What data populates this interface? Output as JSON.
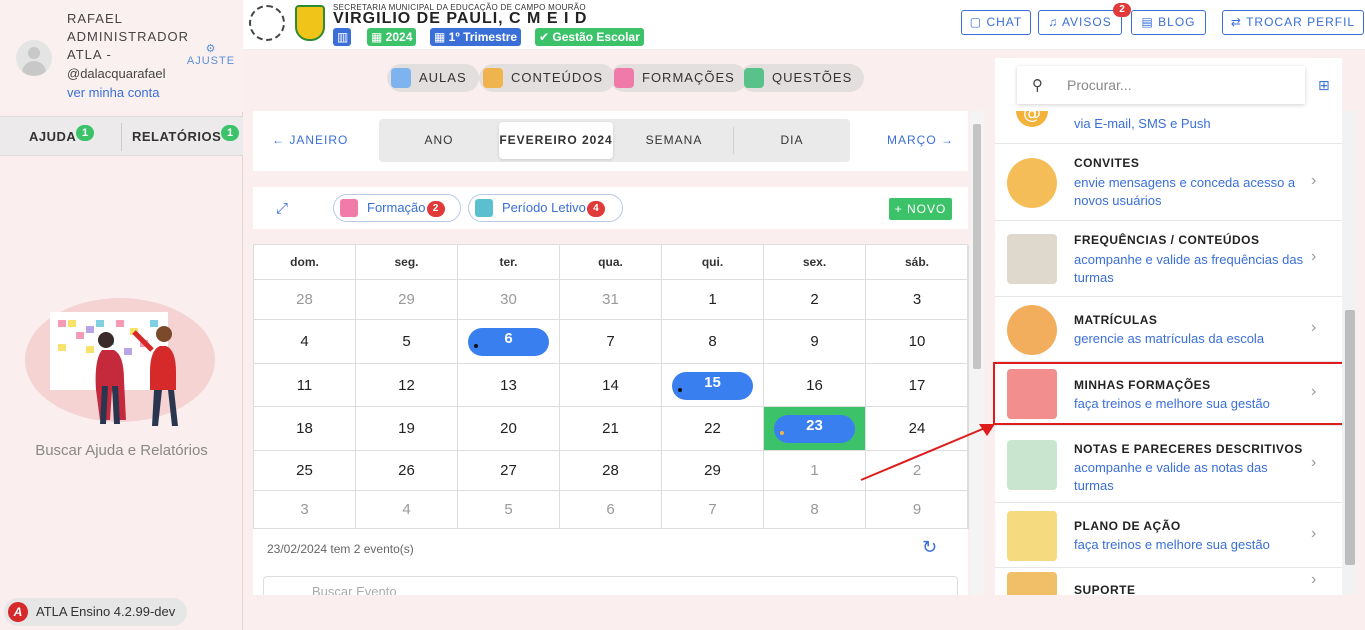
{
  "sidebar": {
    "user_name_line1": "RAFAEL",
    "user_name_line2": "ADMINISTRADOR",
    "user_name_line3": "ATLA -",
    "handle": "@dalacquarafael",
    "account_link": "ver minha conta",
    "settings_label": "AJUSTE",
    "help_tab": "AJUDA",
    "help_count": "1",
    "reports_tab": "RELATÓRIOS",
    "reports_count": "1",
    "help_text": "Buscar Ajuda e Relatórios",
    "version": "ATLA Ensino 4.2.99-dev"
  },
  "header": {
    "department": "SECRETARIA MUNICIPAL DA EDUCAÇÃO DE CAMPO MOURÃO",
    "school": "VIRGILIO DE PAULI, C M E I D",
    "year_chip": "2024",
    "term_chip": "1º Trimestre",
    "mode_chip": "Gestão Escolar",
    "chat_button": "CHAT",
    "notices_button": "AVISOS",
    "notices_count": "2",
    "blog_button": "BLOG",
    "switch_profile_button": "TROCAR PERFIL",
    "colors": {
      "blue": "#3a6fd8",
      "green": "#3cc36a",
      "red": "#e03a3a"
    }
  },
  "modules": [
    "AULAS",
    "CONTEÚDOS",
    "FORMAÇÕES",
    "QUESTÕES"
  ],
  "calendar": {
    "prev_month": "← JANEIRO",
    "next_month": "MARÇO →",
    "views": [
      "ANO",
      "FEVEREIRO 2024",
      "SEMANA",
      "DIA"
    ],
    "active_view": "FEVEREIRO 2024",
    "filters": [
      {
        "label": "Formação",
        "count": "2"
      },
      {
        "label": "Período Letivo",
        "count": "4"
      }
    ],
    "new_button": "NOVO",
    "weekdays": [
      "dom.",
      "seg.",
      "ter.",
      "qua.",
      "qui.",
      "sex.",
      "sáb."
    ],
    "weeks": [
      [
        "28",
        "29",
        "30",
        "31",
        "1",
        "2",
        "3"
      ],
      [
        "4",
        "5",
        "6",
        "7",
        "8",
        "9",
        "10"
      ],
      [
        "11",
        "12",
        "13",
        "14",
        "15",
        "16",
        "17"
      ],
      [
        "18",
        "19",
        "20",
        "21",
        "22",
        "23",
        "24"
      ],
      [
        "25",
        "26",
        "27",
        "28",
        "29",
        "1",
        "2"
      ],
      [
        "3",
        "4",
        "5",
        "6",
        "7",
        "8",
        "9"
      ]
    ],
    "muted_days": [
      [
        0,
        0
      ],
      [
        0,
        1
      ],
      [
        0,
        2
      ],
      [
        0,
        3
      ],
      [
        4,
        5
      ],
      [
        4,
        6
      ],
      [
        5,
        0
      ],
      [
        5,
        1
      ],
      [
        5,
        2
      ],
      [
        5,
        3
      ],
      [
        5,
        4
      ],
      [
        5,
        5
      ],
      [
        5,
        6
      ]
    ],
    "event_days": [
      [
        1,
        2
      ],
      [
        2,
        4
      ],
      [
        3,
        5
      ]
    ],
    "selected_day": [
      3,
      5
    ],
    "events_summary": "23/02/2024 tem 2 evento(s)",
    "search_placeholder": "Buscar Evento"
  },
  "right_panel": {
    "search_placeholder": "Procurar...",
    "partial_item_sub": "via E-mail, SMS e Push",
    "items": [
      {
        "title": "CONVITES",
        "subtitle": "envie mensagens e conceda acesso a novos usuários"
      },
      {
        "title": "FREQUÊNCIAS / CONTEÚDOS",
        "subtitle": "acompanhe e valide as frequências das turmas"
      },
      {
        "title": "MATRÍCULAS",
        "subtitle": "gerencie as matrículas da escola"
      },
      {
        "title": "MINHAS FORMAÇÕES",
        "subtitle": "faça treinos e melhore sua gestão"
      },
      {
        "title": "NOTAS E PARECERES DESCRITIVOS",
        "subtitle": "acompanhe e valide as notas das turmas"
      },
      {
        "title": "PLANO DE AÇÃO",
        "subtitle": "faça treinos e melhore sua gestão"
      },
      {
        "title": "SUPORTE",
        "subtitle": ""
      }
    ],
    "highlighted_item": "MINHAS FORMAÇÕES"
  }
}
